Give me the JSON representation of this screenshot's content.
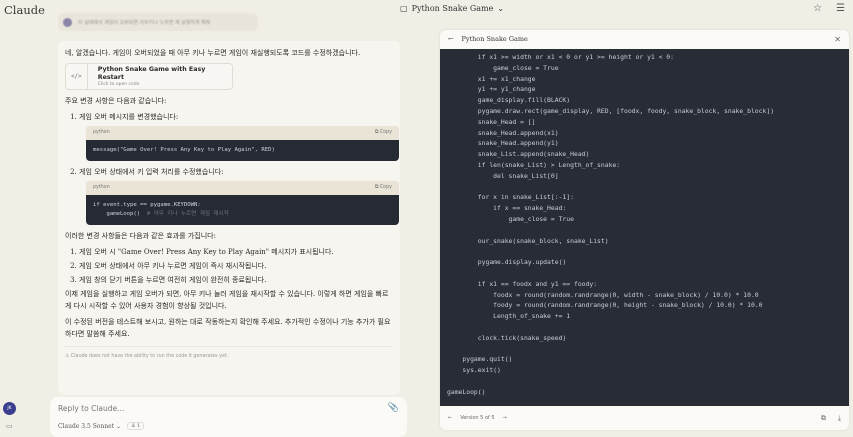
{
  "app": {
    "logo": "Claude",
    "title": "Python Snake Game",
    "title_chevron": "⌄"
  },
  "user_message": "이 상태에서 게임이 오버되면 아무키나 누르면 재 실행하게 해줘",
  "assistant": {
    "intro": "네, 알겠습니다. 게임이 오버되었을 때 아무 키나 누르면 게임이 재실행되도록 코드를 수정하겠습니다.",
    "artifact": {
      "title": "Python Snake Game with Easy Restart",
      "subtitle": "Click to open code",
      "icon": "</>"
    },
    "changes_heading": "주요 변경 사항은 다음과 같습니다:",
    "changes": [
      {
        "label": "게임 오버 메시지를 변경했습니다:",
        "lang": "python",
        "copy": "Copy",
        "code": "message(\"Game Over! Press Any Key to Play Again\", RED)",
        "comment": ""
      },
      {
        "label": "게임 오버 상태에서 키 입력 처리를 수정했습니다:",
        "lang": "python",
        "copy": "Copy",
        "code": "if event.type == pygame.KEYDOWN:\n    gameLoop()  ",
        "comment": "# 아무 키나 누르면 게임 재시작"
      }
    ],
    "effects_heading": "이러한 변경 사항들은 다음과 같은 효과를 가집니다:",
    "effects": [
      "게임 오버 시 \"Game Over! Press Any Key to Play Again\" 메시지가 표시됩니다.",
      "게임 오버 상태에서 아무 키나 누르면 게임이 즉시 재시작됩니다.",
      "게임 창의 닫기 버튼을 누르면 여전히 게임이 완전히 종료됩니다."
    ],
    "para1": "이제 게임을 실행하고 게임 오버가 되면, 아무 키나 눌러 게임을 재시작할 수 있습니다. 이렇게 하면 게임을 빠르게 다시 시작할 수 있어 사용자 경험이 향상될 것입니다.",
    "para2": "이 수정된 버전을 테스트해 보시고, 원하는 대로 작동하는지 확인해 주세요. 추가적인 수정이나 기능 추가가 필요하다면 말씀해 주세요.",
    "warning": "Claude does not have the ability to run the code it generates yet."
  },
  "input": {
    "placeholder": "Reply to Claude...",
    "model": "Claude 3.5 Sonnet",
    "model_chevron": "⌄",
    "count": "1"
  },
  "user": {
    "initials": "JK"
  },
  "panel": {
    "title": "Python Snake Game",
    "version": "Version 5 of 5",
    "code_lines": [
      "        if x1 >= width or x1 < 0 or y1 >= height or y1 < 0:",
      "            game_close = True",
      "        x1 += x1_change",
      "        y1 += y1_change",
      "        game_display.fill(BLACK)",
      "        pygame.draw.rect(game_display, RED, [foodx, foody, snake_block, snake_block])",
      "        snake_Head = []",
      "        snake_Head.append(x1)",
      "        snake_Head.append(y1)",
      "        snake_List.append(snake_Head)",
      "        if len(snake_List) > Length_of_snake:",
      "            del snake_List[0]",
      "",
      "        for x in snake_List[:-1]:",
      "            if x == snake_Head:",
      "                game_close = True",
      "",
      "        our_snake(snake_block, snake_List)",
      "",
      "        pygame.display.update()",
      "",
      "        if x1 == foodx and y1 == foody:",
      "            foodx = round(random.randrange(0, width - snake_block) / 10.0) * 10.0",
      "            foody = round(random.randrange(0, height - snake_block) / 10.0) * 10.0",
      "            Length_of_snake += 1",
      "",
      "        clock.tick(snake_speed)",
      "",
      "    pygame.quit()",
      "    sys.exit()",
      "",
      "gameLoop()"
    ]
  }
}
